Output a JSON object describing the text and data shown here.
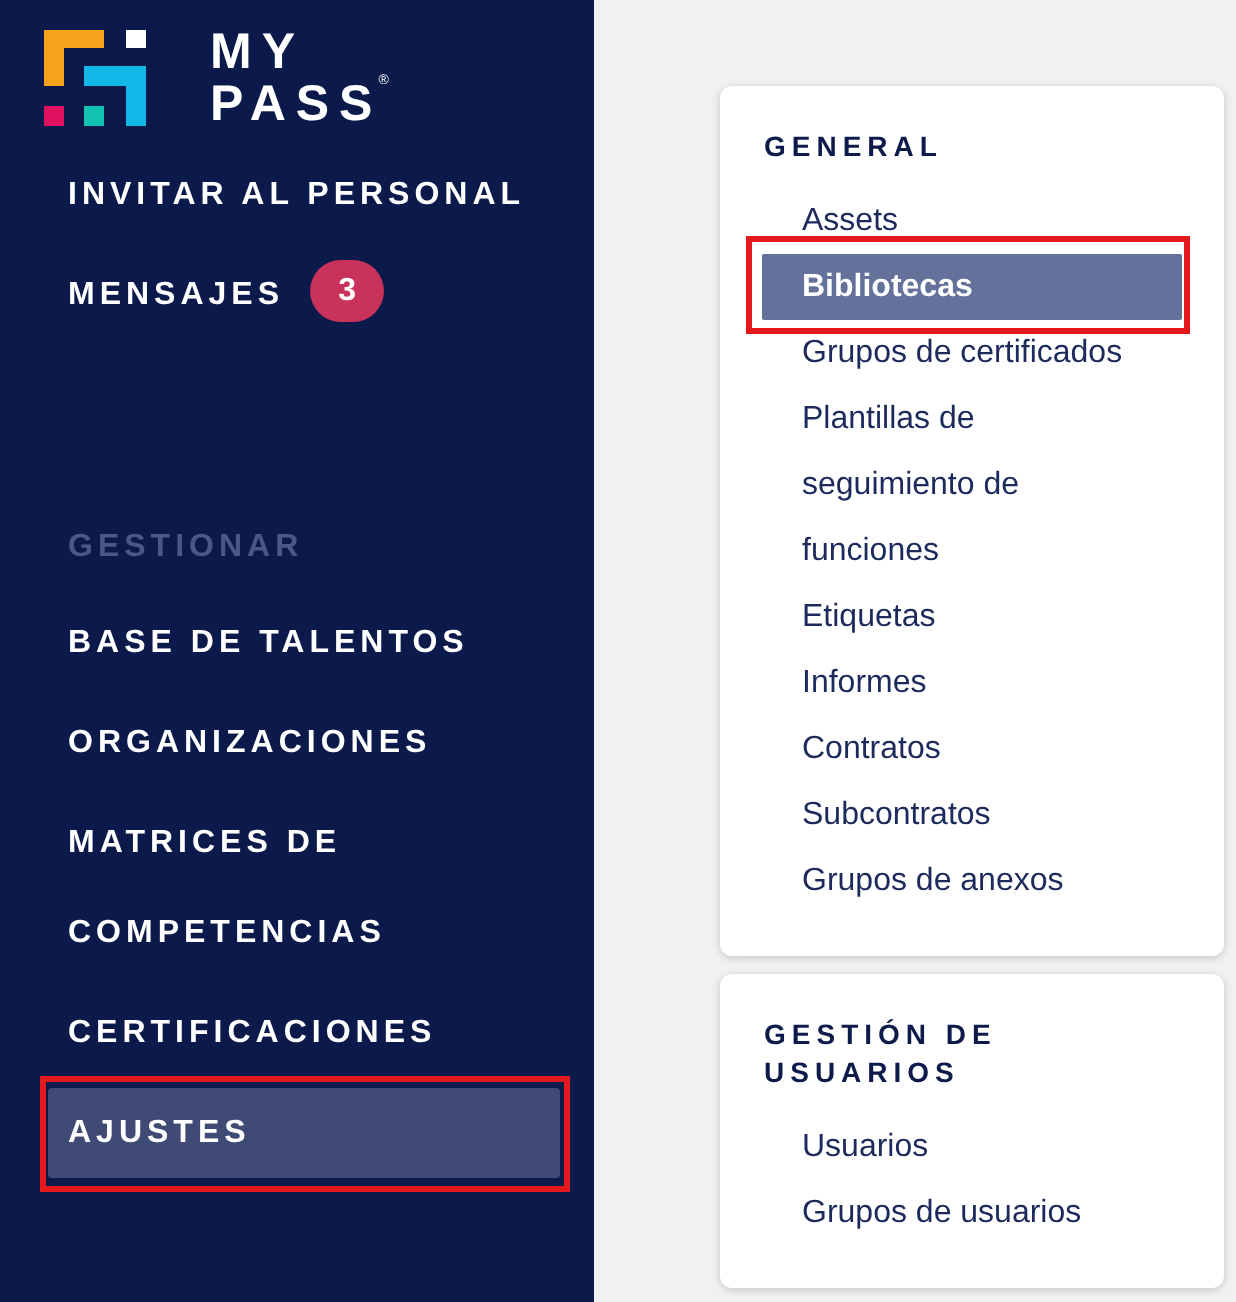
{
  "brand": {
    "wordmark_line_1": "MY",
    "wordmark_line_2": "PASS",
    "registered_mark": "®"
  },
  "sidebar": {
    "items": [
      {
        "label": "INVITAR AL PERSONAL",
        "selected": false,
        "highlighted": false
      },
      {
        "label": "MENSAJES",
        "badge": "3",
        "selected": false,
        "highlighted": false
      }
    ],
    "sections": [
      {
        "title": "GESTIONAR",
        "items": [
          {
            "label": "BASE DE TALENTOS",
            "selected": false,
            "highlighted": false
          },
          {
            "label": "ORGANIZACIONES",
            "selected": false,
            "highlighted": false
          },
          {
            "label": "MATRICES DE COMPETENCIAS",
            "selected": false,
            "highlighted": false
          },
          {
            "label": "CERTIFICACIONES",
            "selected": false,
            "highlighted": false
          },
          {
            "label": "AJUSTES",
            "selected": true,
            "highlighted": true
          }
        ]
      }
    ]
  },
  "settings_menu": {
    "groups": [
      {
        "title": "GENERAL",
        "items": [
          {
            "label": "Assets",
            "selected": false,
            "highlighted": false
          },
          {
            "label": "Bibliotecas",
            "selected": true,
            "highlighted": true
          },
          {
            "label": "Grupos de certificados",
            "selected": false,
            "highlighted": false
          },
          {
            "label": "Plantillas de seguimiento de funciones",
            "selected": false,
            "highlighted": false
          },
          {
            "label": "Etiquetas",
            "selected": false,
            "highlighted": false
          },
          {
            "label": "Informes",
            "selected": false,
            "highlighted": false
          },
          {
            "label": "Contratos",
            "selected": false,
            "highlighted": false
          },
          {
            "label": "Subcontratos",
            "selected": false,
            "highlighted": false
          },
          {
            "label": "Grupos de anexos",
            "selected": false,
            "highlighted": false
          }
        ]
      },
      {
        "title": "GESTIÓN DE USUARIOS",
        "items": [
          {
            "label": "Usuarios",
            "selected": false,
            "highlighted": false
          },
          {
            "label": "Grupos de usuarios",
            "selected": false,
            "highlighted": false
          }
        ]
      }
    ]
  }
}
